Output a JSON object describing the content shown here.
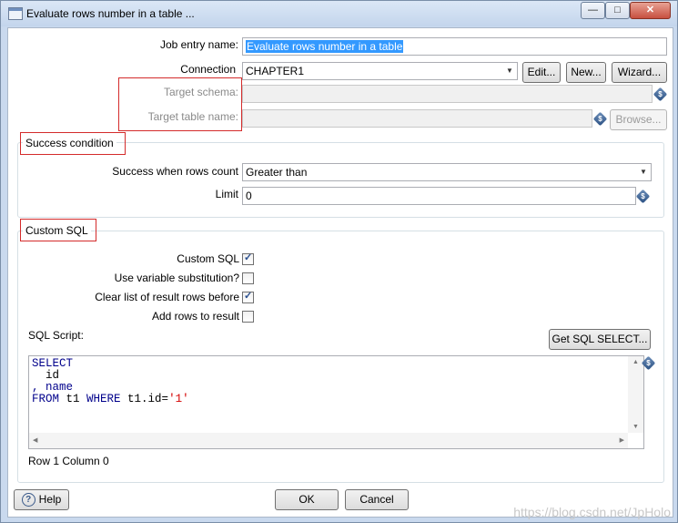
{
  "window": {
    "title": "Evaluate rows number in a table ...",
    "minimize": "—",
    "maximize": "□",
    "close": "✕"
  },
  "form": {
    "job_entry_name_label": "Job entry name:",
    "job_entry_name_value": "Evaluate rows number in a table",
    "connection_label": "Connection",
    "connection_value": "CHAPTER1",
    "edit_button": "Edit...",
    "new_button": "New...",
    "wizard_button": "Wizard...",
    "target_schema_label": "Target schema:",
    "target_schema_value": "",
    "target_table_label": "Target table name:",
    "target_table_value": "",
    "browse_button": "Browse..."
  },
  "success_group": {
    "title": "Success condition",
    "rows_count_label": "Success when rows count",
    "rows_count_value": "Greater than",
    "limit_label": "Limit",
    "limit_value": "0"
  },
  "custom_sql_group": {
    "title": "Custom SQL",
    "options": [
      {
        "label": "Custom SQL",
        "checked": true
      },
      {
        "label": "Use variable substitution?",
        "checked": false
      },
      {
        "label": "Clear list of result rows before",
        "checked": true
      },
      {
        "label": "Add rows to result",
        "checked": false
      }
    ],
    "sql_script_label": "SQL Script:",
    "get_sql_button": "Get SQL SELECT...",
    "sql_lines": {
      "l1": "SELECT",
      "l2": "  id",
      "l3": ", name",
      "l4_kw1": "FROM",
      "l4_t1": " t1 ",
      "l4_kw2": "WHERE",
      "l4_t2": " t1.id=",
      "l4_str": "'1'"
    },
    "position_status": "Row 1 Column 0"
  },
  "footer": {
    "help_icon_glyph": "?",
    "help_button": "Help",
    "ok_button": "OK",
    "cancel_button": "Cancel"
  },
  "variable_icon_glyph": "$",
  "watermark": "https://blog.csdn.net/JpHolo",
  "icons": [
    "app-icon",
    "dropdown-arrow-icon",
    "variable-icon",
    "checkbox-icon",
    "help-icon",
    "scroll-arrow-icon"
  ],
  "colors": {
    "selection": "#3399ff",
    "sql_keyword": "#00008b",
    "sql_string": "#d40000",
    "highlight_box": "#d42b2b"
  }
}
